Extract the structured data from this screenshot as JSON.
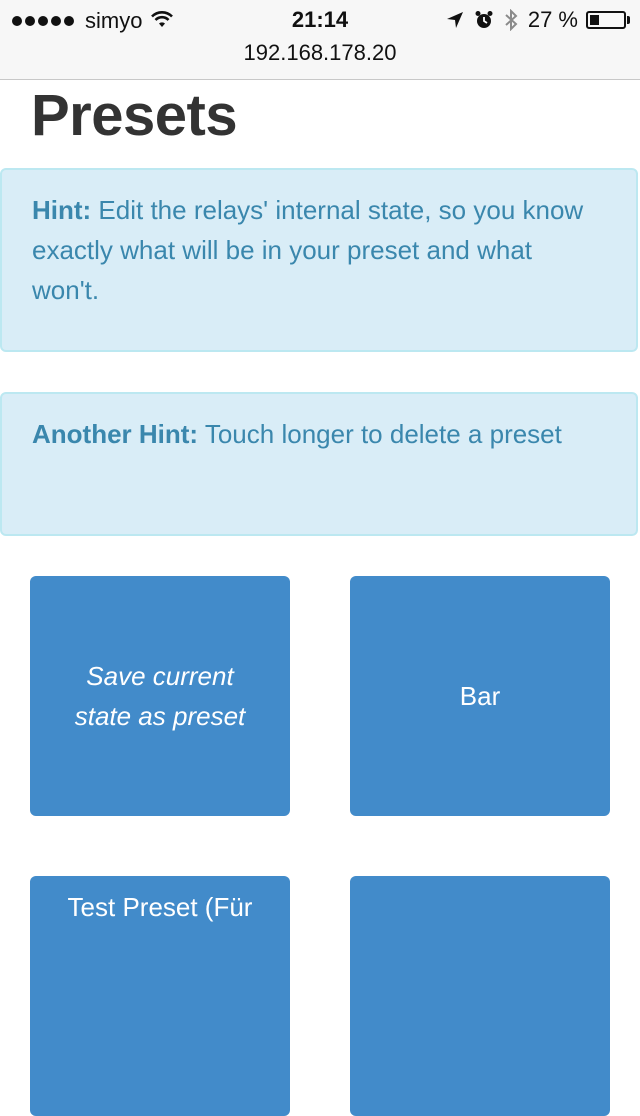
{
  "status_bar": {
    "carrier": "simyo",
    "time": "21:14",
    "battery": "27 %",
    "battery_level": 0.27,
    "icons": [
      "signal-dots-icon",
      "wifi-icon",
      "location-arrow-icon",
      "alarm-icon",
      "bluetooth-icon",
      "battery-icon"
    ]
  },
  "browser": {
    "url": "192.168.178.20"
  },
  "page": {
    "title": "Presets"
  },
  "hints": [
    {
      "label": "Hint:",
      "text": " Edit the relays' internal state, so you know exactly what will be in your preset and what won't."
    },
    {
      "label": "Another Hint:",
      "text": " Touch longer to delete a preset"
    }
  ],
  "presets": [
    {
      "label": "Save current state as preset"
    },
    {
      "label": "Bar"
    },
    {
      "label": "Test Preset (Für"
    },
    {
      "label": ""
    }
  ],
  "colors": {
    "tile": "#428bca",
    "alert_bg": "#d9edf7",
    "alert_border": "#bce8f1",
    "alert_text": "#3a87ad",
    "title": "#333333"
  }
}
